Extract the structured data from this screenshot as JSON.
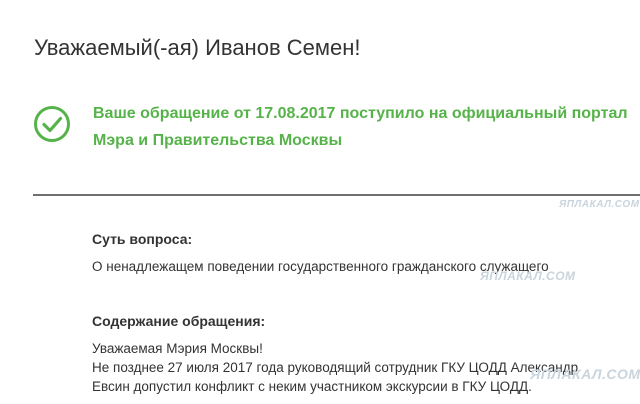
{
  "greeting": "Уважаемый(-ая) Иванов Семен!",
  "notice": {
    "line1": "Ваше обращение от 17.08.2017 поступило на официальный портал",
    "line2": "Мэра и Правительства Москвы",
    "icon": "check-circle-icon",
    "color": "#56b34a"
  },
  "question": {
    "label": "Суть вопроса:",
    "text": "О ненадлежащем поведении государственного гражданского служащего"
  },
  "content": {
    "label": "Содержание обращения:",
    "lines": [
      "Уважаемая Мэрия Москвы!",
      "Не позднее 27 июля 2017 года руководящий сотрудник ГКУ ЦОДД Александр",
      "Евсин допустил конфликт с неким участником экскурсии в ГКУ ЦОДД."
    ]
  },
  "watermarks": {
    "small": "ЯПЛАКАЛ.COM",
    "mid": "ЯПЛАКАЛ.COM",
    "big": "ЯПЛАКАЛ.COM"
  }
}
